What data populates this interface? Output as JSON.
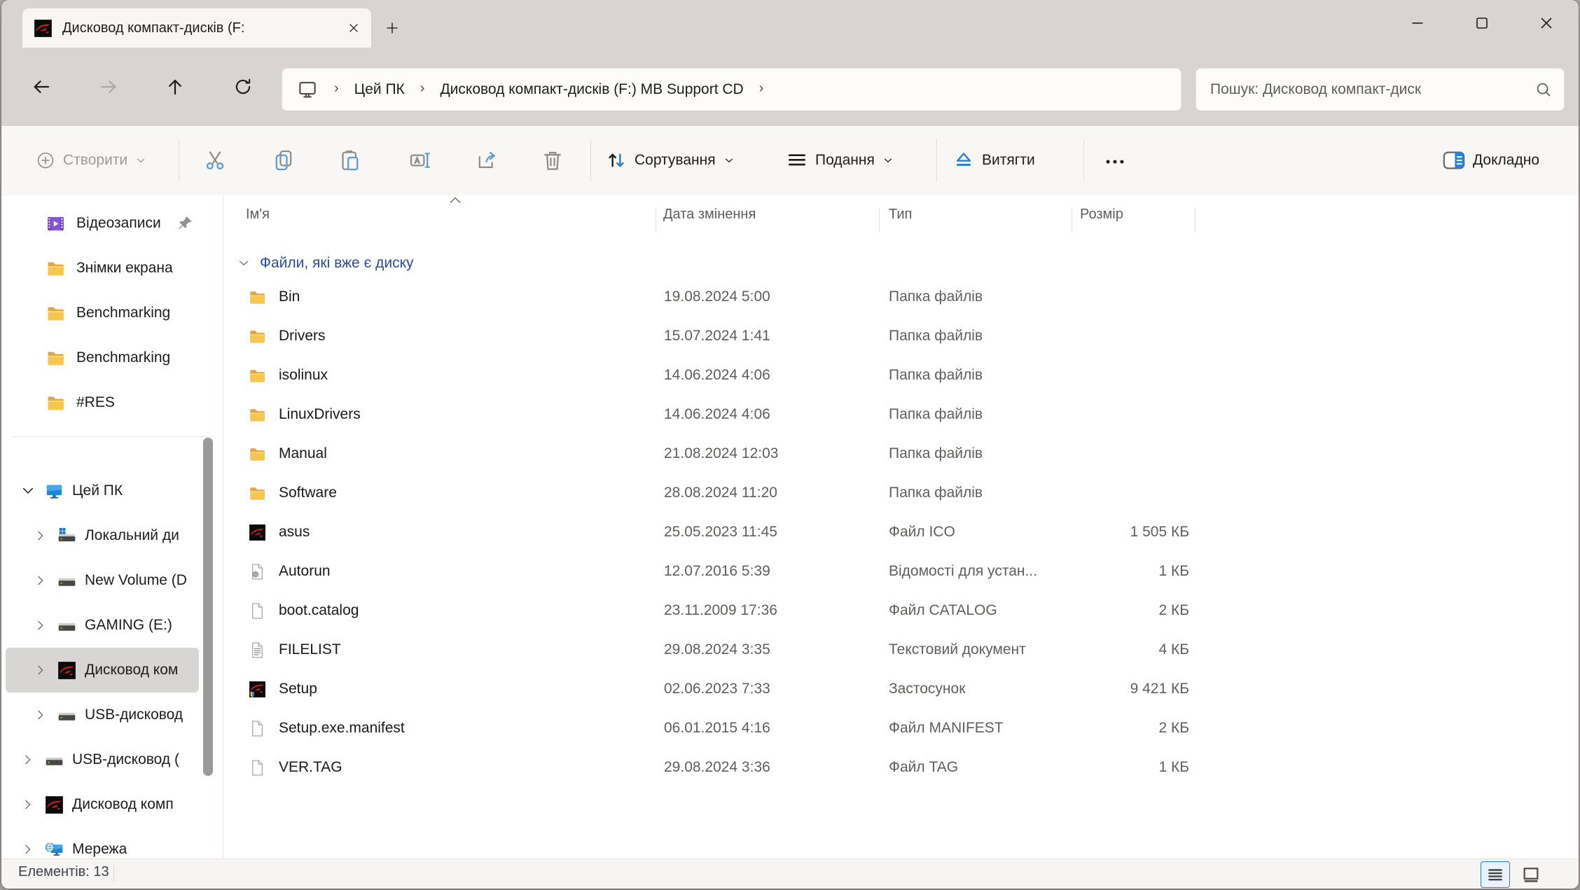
{
  "window": {
    "tab_title": "Дисковод компакт-дисків (F:"
  },
  "nav": {
    "breadcrumb": {
      "root_label": "Цей ПК",
      "path_label": "Дисковод компакт-дисків (F:) MB Support CD"
    }
  },
  "search": {
    "placeholder": "Пошук: Дисковод компакт-диск"
  },
  "toolbar": {
    "new_label": "Створити",
    "sort_label": "Сортування",
    "view_label": "Подання",
    "eject_label": "Витягти",
    "details_label": "Докладно"
  },
  "sidebar": {
    "pinned": [
      {
        "label": "Відеозаписи",
        "icon": "video",
        "pinned": true
      },
      {
        "label": "Знімки екрана",
        "icon": "folder",
        "pinned": false
      },
      {
        "label": "Benchmarking",
        "icon": "folder",
        "pinned": false
      },
      {
        "label": "Benchmarking",
        "icon": "folder",
        "pinned": false
      },
      {
        "label": "#RES",
        "icon": "folder",
        "pinned": false
      }
    ],
    "tree": [
      {
        "label": "Цей ПК",
        "icon": "this-pc",
        "level": 0,
        "expanded": true,
        "selected": false
      },
      {
        "label": "Локальний ди",
        "icon": "disk-win",
        "level": 1,
        "expanded": false,
        "selected": false
      },
      {
        "label": "New Volume (D",
        "icon": "disk",
        "level": 1,
        "expanded": false,
        "selected": false
      },
      {
        "label": "GAMING (E:)",
        "icon": "disk",
        "level": 1,
        "expanded": false,
        "selected": false
      },
      {
        "label": "Дисковод ком",
        "icon": "rog",
        "level": 1,
        "expanded": false,
        "selected": true
      },
      {
        "label": "USB-дисковод",
        "icon": "disk",
        "level": 1,
        "expanded": false,
        "selected": false
      },
      {
        "label": "USB-дисковод (",
        "icon": "disk",
        "level": 0,
        "expanded": false,
        "selected": false
      },
      {
        "label": "Дисковод комп",
        "icon": "rog",
        "level": 0,
        "expanded": false,
        "selected": false
      },
      {
        "label": "Мережа",
        "icon": "network",
        "level": 0,
        "expanded": false,
        "selected": false
      }
    ]
  },
  "main": {
    "columns": [
      "Ім'я",
      "Дата змінення",
      "Тип",
      "Розмір"
    ],
    "group_label": "Файли, які вже є диску",
    "files": [
      {
        "name": "Bin",
        "date": "19.08.2024 5:00",
        "type": "Папка файлів",
        "size": "",
        "icon": "folder"
      },
      {
        "name": "Drivers",
        "date": "15.07.2024 1:41",
        "type": "Папка файлів",
        "size": "",
        "icon": "folder"
      },
      {
        "name": "isolinux",
        "date": "14.06.2024 4:06",
        "type": "Папка файлів",
        "size": "",
        "icon": "folder"
      },
      {
        "name": "LinuxDrivers",
        "date": "14.06.2024 4:06",
        "type": "Папка файлів",
        "size": "",
        "icon": "folder"
      },
      {
        "name": "Manual",
        "date": "21.08.2024 12:03",
        "type": "Папка файлів",
        "size": "",
        "icon": "folder"
      },
      {
        "name": "Software",
        "date": "28.08.2024 11:20",
        "type": "Папка файлів",
        "size": "",
        "icon": "folder"
      },
      {
        "name": "asus",
        "date": "25.05.2023 11:45",
        "type": "Файл ICO",
        "size": "1 505 КБ",
        "icon": "rog"
      },
      {
        "name": "Autorun",
        "date": "12.07.2016 5:39",
        "type": "Відомості для устан...",
        "size": "1 КБ",
        "icon": "doc-gear"
      },
      {
        "name": "boot.catalog",
        "date": "23.11.2009 17:36",
        "type": "Файл CATALOG",
        "size": "2 КБ",
        "icon": "doc"
      },
      {
        "name": "FILELIST",
        "date": "29.08.2024 3:35",
        "type": "Текстовий документ",
        "size": "4 КБ",
        "icon": "doc-text"
      },
      {
        "name": "Setup",
        "date": "02.06.2023 7:33",
        "type": "Застосунок",
        "size": "9 421 КБ",
        "icon": "rog-shield"
      },
      {
        "name": "Setup.exe.manifest",
        "date": "06.01.2015 4:16",
        "type": "Файл MANIFEST",
        "size": "2 КБ",
        "icon": "doc"
      },
      {
        "name": "VER.TAG",
        "date": "29.08.2024 3:36",
        "type": "Файл TAG",
        "size": "1 КБ",
        "icon": "doc"
      }
    ]
  },
  "status": {
    "items_text": "Елементів: 13"
  },
  "colors": {
    "accent": "#2b7bd1",
    "group_header": "#2b4ba6",
    "sidebar_selected": "#d8d6d4",
    "folder_yellow": "#f7c64e"
  }
}
